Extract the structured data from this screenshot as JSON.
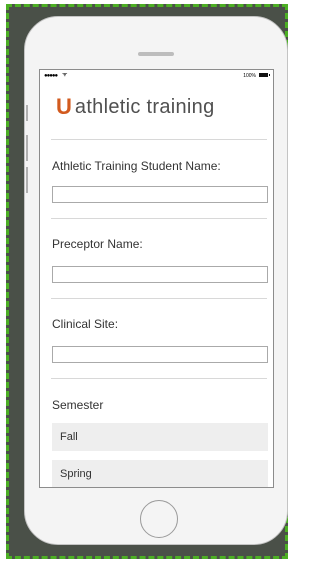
{
  "status_bar": {
    "signal": "●●●●●",
    "wifi": "ᯤ",
    "battery_percent": "100%"
  },
  "app": {
    "logo_mark": "U",
    "logo_text": "athletic training"
  },
  "form": {
    "student_name_label": "Athletic Training Student Name:",
    "student_name_value": "",
    "preceptor_label": "Preceptor Name:",
    "preceptor_value": "",
    "site_label": "Clinical Site:",
    "site_value": "",
    "semester_label": "Semester",
    "semester_options": [
      "Fall",
      "Spring"
    ]
  },
  "colors": {
    "brand": "#d25a1e",
    "frame_border": "#4caf24",
    "frame_bg": "#4a5048"
  }
}
